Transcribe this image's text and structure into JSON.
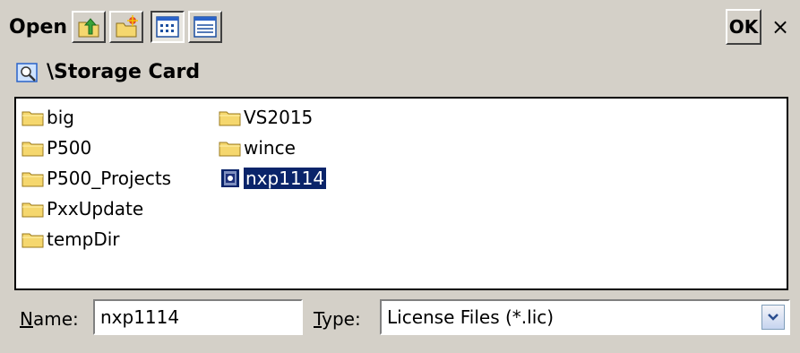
{
  "dialog": {
    "title": "Open",
    "ok_label": "OK",
    "close_label": "×"
  },
  "toolbar": {
    "buttons": [
      {
        "icon": "up-folder-icon"
      },
      {
        "icon": "new-folder-icon"
      },
      {
        "icon": "list-view-icon",
        "pressed": true
      },
      {
        "icon": "details-view-icon"
      }
    ]
  },
  "path": {
    "icon": "folder-search-icon",
    "text": "\\Storage Card"
  },
  "files": [
    {
      "name": "big",
      "type": "folder"
    },
    {
      "name": "P500",
      "type": "folder"
    },
    {
      "name": "P500_Projects",
      "type": "folder"
    },
    {
      "name": "PxxUpdate",
      "type": "folder"
    },
    {
      "name": "tempDir",
      "type": "folder"
    },
    {
      "name": "VS2015",
      "type": "folder"
    },
    {
      "name": "wince",
      "type": "folder"
    },
    {
      "name": "nxp1114",
      "type": "file",
      "selected": true
    }
  ],
  "name_field": {
    "label_underlined": "N",
    "label_rest": "ame:",
    "value": "nxp1114"
  },
  "type_field": {
    "label_underlined": "T",
    "label_rest": "ype:",
    "value": "License Files (*.lic)"
  },
  "colors": {
    "dialog_bg": "#d4d0c8",
    "selection": "#0a246a",
    "folder_yellow": "#f5d76e"
  }
}
